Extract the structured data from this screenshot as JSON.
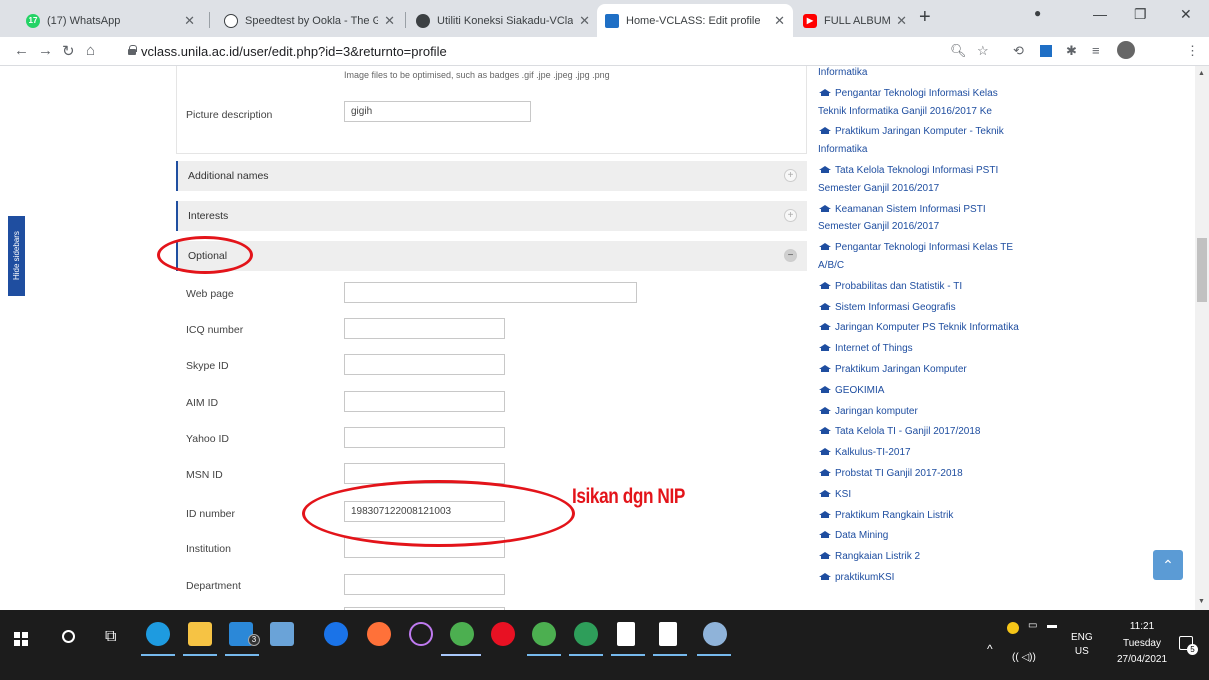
{
  "browser": {
    "tabs": [
      {
        "title": "(17) WhatsApp",
        "active": false
      },
      {
        "title": "Speedtest by Ookla - The Glo",
        "active": false
      },
      {
        "title": "Utiliti Koneksi Siakadu-VClass",
        "active": false
      },
      {
        "title": "Home-VCLASS: Edit profile",
        "active": true
      },
      {
        "title": "FULL ALBUM COVER FELI",
        "active": false
      }
    ],
    "url": "vclass.unila.ac.id/user/edit.php?id=3&returnto=profile"
  },
  "page": {
    "hide_sidebars": "Hide sidebars",
    "image_hint": "Image files to be optimised, such as badges .gif .jpe .jpeg .jpg .png",
    "picture_description": {
      "label": "Picture description",
      "value": "gigih"
    },
    "sections": {
      "additional_names": "Additional names",
      "interests": "Interests",
      "optional": "Optional"
    },
    "fields": {
      "web_page": {
        "label": "Web page",
        "value": ""
      },
      "icq": {
        "label": "ICQ number",
        "value": ""
      },
      "skype": {
        "label": "Skype ID",
        "value": ""
      },
      "aim": {
        "label": "AIM ID",
        "value": ""
      },
      "yahoo": {
        "label": "Yahoo ID",
        "value": ""
      },
      "msn": {
        "label": "MSN ID",
        "value": ""
      },
      "id_number": {
        "label": "ID number",
        "value": "198307122008121003"
      },
      "institution": {
        "label": "Institution",
        "value": ""
      },
      "department": {
        "label": "Department",
        "value": ""
      }
    },
    "annotation_text": "Isikan dgn NIP",
    "courses": [
      "Informatika",
      "Pengantar Teknologi Informasi Kelas Teknik Informatika Ganjil 2016/2017 Ke",
      "Praktikum Jaringan Komputer - Teknik Informatika",
      "Tata Kelola Teknologi Informasi PSTI Semester Ganjil 2016/2017",
      "Keamanan Sistem Informasi PSTI Semester Ganjil 2016/2017",
      "Pengantar Teknologi Informasi Kelas TE A/B/C",
      "Probabilitas dan Statistik - TI",
      "Sistem Informasi Geografis",
      "Jaringan Komputer PS Teknik Informatika",
      "Internet of Things",
      "Praktikum Jaringan Komputer",
      "GEOKIMIA",
      "Jaringan komputer",
      "Tata Kelola TI - Ganjil 2017/2018",
      "Kalkulus-TI-2017",
      "Probstat TI Ganjil 2017-2018",
      "KSI",
      "Praktikum Rangkain Listrik",
      "Data Mining",
      "Rangkaian Listrik 2",
      "praktikumKSI"
    ]
  },
  "taskbar": {
    "lang": "ENG",
    "region": "US",
    "time": "11:21",
    "day": "Tuesday",
    "date": "27/04/2021",
    "notification_count": "5",
    "mail_badge": "3"
  }
}
